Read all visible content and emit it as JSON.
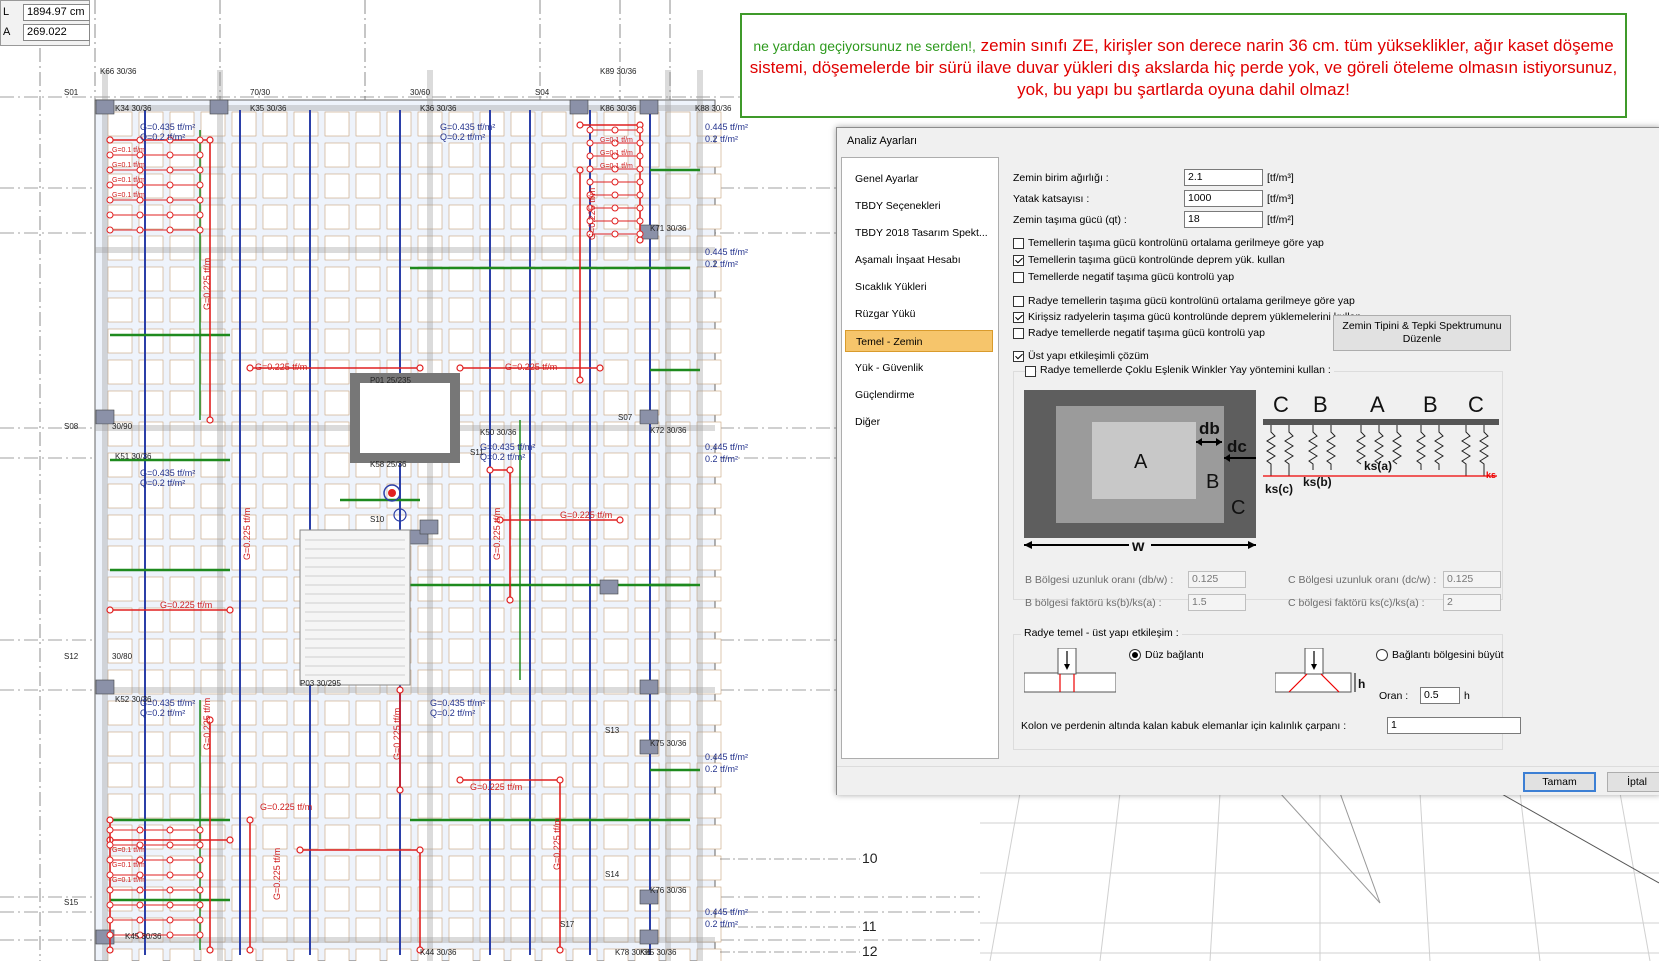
{
  "measure": {
    "rows": [
      {
        "label": "L",
        "value": "1894.97 cm"
      },
      {
        "label": "A",
        "value": "269.022"
      }
    ]
  },
  "callout": {
    "lead": "ne yardan geçiyorsunuz ne serden!,",
    "body": "zemin sınıfı ZE, kirişler son derece narin 36 cm. tüm yükseklikler, ağır kaset döşeme sistemi, döşemelerde bir sürü ilave duvar yükleri dış akslarda hiç perde yok, ve göreli öteleme olmasın istiyorsunuz,  yok, bu yapı bu şartlarda oyuna dahil olmaz!"
  },
  "dialog": {
    "title": "Analiz Ayarları",
    "nav": [
      {
        "label": "Genel Ayarlar",
        "active": false
      },
      {
        "label": "TBDY Seçenekleri",
        "active": false
      },
      {
        "label": "TBDY 2018 Tasarım Spekt...",
        "active": false
      },
      {
        "label": "Aşamalı İnşaat Hesabı",
        "active": false
      },
      {
        "label": "Sıcaklık Yükleri",
        "active": false
      },
      {
        "label": "Rüzgar Yükü",
        "active": false
      },
      {
        "label": "Temel - Zemin",
        "active": true
      },
      {
        "label": "Yük - Güvenlik",
        "active": false
      },
      {
        "label": "Güçlendirme",
        "active": false
      },
      {
        "label": "Diğer",
        "active": false
      }
    ],
    "fields": [
      {
        "label": "Zemin birim ağırlığı :",
        "value": "2.1",
        "unit": "[tf/m³]"
      },
      {
        "label": "Yatak katsayısı :",
        "value": "1000",
        "unit": "[tf/m³]"
      },
      {
        "label": "Zemin taşıma gücü (qt) :",
        "value": "18",
        "unit": "[tf/m²]"
      }
    ],
    "checks_a": [
      {
        "label": "Temellerin taşıma gücü kontrolünü ortalama gerilmeye göre yap",
        "checked": false
      },
      {
        "label": "Temellerin taşıma gücü kontrolünde deprem yük. kullan",
        "checked": true
      },
      {
        "label": "Temellerde negatif taşıma gücü kontrolü yap",
        "checked": false
      }
    ],
    "checks_b": [
      {
        "label": "Radye temellerin taşıma gücü kontrolünü ortalama gerilmeye göre yap",
        "checked": false
      },
      {
        "label": "Kirişsiz radyelerin taşıma gücü kontrolünde deprem yüklemelerini kullan",
        "checked": true
      },
      {
        "label": "Radye temellerde negatif taşıma gücü kontrolü yap",
        "checked": false
      }
    ],
    "ust_yapi": {
      "label": "Üst yapı etkileşimli çözüm",
      "checked": true
    },
    "zemin_button": "Zemin Tipini  & Tepki Spektrumunu Düzenle",
    "winkler": {
      "label": "Radye temellerde Çoklu Eşlenik Winkler Yay yöntemini kullan :",
      "checked": false,
      "diagram": {
        "zone_a": "A",
        "zone_b": "B",
        "zone_c": "C",
        "db": "db",
        "dc": "dc",
        "w": "w",
        "spring_labels": [
          "C",
          "B",
          "A",
          "B",
          "C"
        ],
        "ks_a": "ks(a)",
        "ks_b": "ks(b)",
        "ks_c": "ks(c)",
        "ks_end": "ks"
      },
      "b_len_label": "B Bölgesi uzunluk oranı (db/w) :",
      "b_len_value": "0.125",
      "c_len_label": "C Bölgesi uzunluk oranı (dc/w) :",
      "c_len_value": "0.125",
      "b_fac_label": "B bölgesi faktörü ks(b)/ks(a) :",
      "b_fac_value": "1.5",
      "c_fac_label": "C bölgesi faktörü ks(c)/ks(a) :",
      "c_fac_value": "2"
    },
    "radye": {
      "title": "Radye temel - üst yapı etkileşim :",
      "option1": "Düz bağlantı",
      "option2": "Bağlantı bölgesini büyüt",
      "oran_label": "Oran :",
      "oran_value": "0.5",
      "oran_unit": "h",
      "h_label": "h",
      "kalinlik_label": "Kolon ve perdenin altında kalan kabuk elemanlar için kalınlık çarpanı :",
      "kalinlik_value": "1"
    },
    "buttons": {
      "ok": "Tamam",
      "cancel": "İptal"
    }
  },
  "plan": {
    "axis_marks": [
      "10",
      "11",
      "12"
    ],
    "labels": [
      "K66 30/36",
      "K89 30/36",
      "K34 30/36",
      "K35 30/36",
      "K36 30/36",
      "K86 30/36",
      "K88 30/36",
      "K71 30/36",
      "K72 30/36",
      "K51 30/36",
      "K50 30/36",
      "K58 25/36",
      "P01 25/235",
      "P03 30/295",
      "K52 30/36",
      "K75 30/36",
      "K76 30/36",
      "K45 30/36",
      "K44 30/36",
      "K78 30/36",
      "K85 30/36",
      "S01",
      "S04",
      "S07",
      "S08",
      "S12",
      "S13",
      "S14",
      "S15",
      "S17",
      "S10",
      "S11",
      "70/30",
      "30/60",
      "30/90",
      "30/80"
    ],
    "load_text_g": "G=0.435 tf/m²",
    "load_text_q": "Q=0.2 tf/m²",
    "wall_load": "G=0.225 tf/m",
    "area_load": "0.445 tf/m²",
    "area_load_q": "0.2 tf/m²",
    "misc_small": [
      "G=0.1 tf/m",
      "1"
    ]
  }
}
